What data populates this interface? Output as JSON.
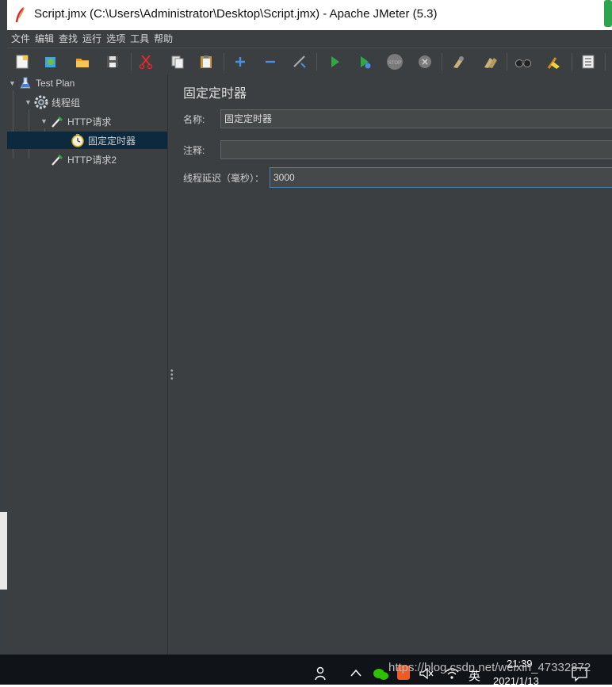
{
  "window": {
    "title": "Script.jmx (C:\\Users\\Administrator\\Desktop\\Script.jmx) - Apache JMeter (5.3)"
  },
  "menu": [
    "文件",
    "编辑",
    "查找",
    "运行",
    "选项",
    "工具",
    "帮助"
  ],
  "toolbar_icons": [
    "new-icon",
    "templates-icon",
    "open-icon",
    "save-icon",
    "cut-icon",
    "copy-icon",
    "paste-icon",
    "expand-icon",
    "collapse-icon",
    "toggle-icon",
    "start-icon",
    "start-no-pause-icon",
    "stop-icon",
    "shutdown-icon",
    "clear-icon",
    "clear-all-icon",
    "search-icon",
    "reset-search-icon",
    "function-helper-icon"
  ],
  "tree": {
    "nodes": [
      {
        "label": "Test Plan",
        "icon": "flask-icon"
      },
      {
        "label": "线程组",
        "icon": "gear-icon"
      },
      {
        "label": "HTTP请求",
        "icon": "pipette-icon"
      },
      {
        "label": "固定定时器",
        "icon": "timer-icon",
        "selected": true
      },
      {
        "label": "HTTP请求2",
        "icon": "pipette-icon"
      }
    ]
  },
  "panel": {
    "heading": "固定定时器",
    "name_label": "名称:",
    "name_value": "固定定时器",
    "comment_label": "注释:",
    "comment_value": "",
    "delay_label": "线程延迟（毫秒）：",
    "delay_value": "3000"
  },
  "taskbar": {
    "time": "21:39",
    "date": "2021/1/13",
    "ime": "英",
    "watermark": "https://blog.csdn.net/weixin_47332872"
  },
  "colors": {
    "background": "#3c3f41",
    "selection": "#0d293e",
    "focus_border": "#4a7fb3",
    "start_green": "#2fa845"
  }
}
